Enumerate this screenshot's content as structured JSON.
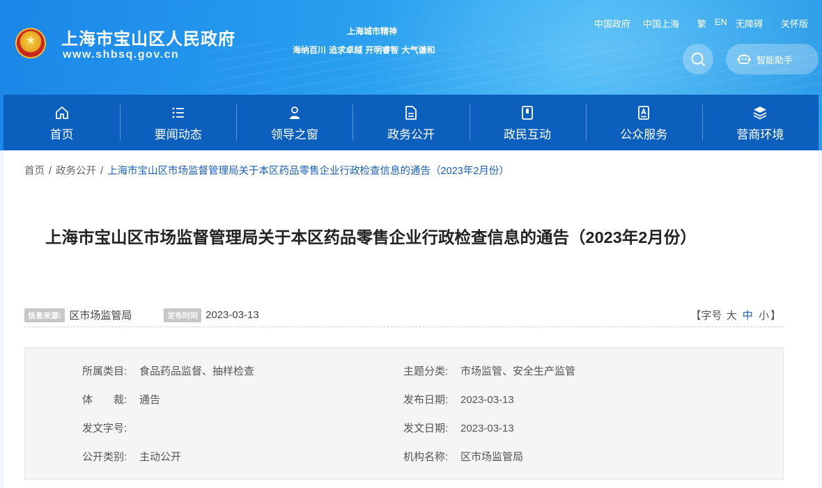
{
  "header": {
    "site_title": "上海市宝山区人民政府",
    "site_url": "www.shbsq.gov.cn",
    "spirit_title": "上海城市精神",
    "spirit_motto": "海纳百川 追求卓越 开明睿智 大气谦和",
    "top_links": {
      "china_gov": "中国政府",
      "shanghai": "中国上海",
      "traditional": "繁",
      "english": "EN",
      "accessibility": "无障碍",
      "care": "关怀版"
    },
    "assistant_label": "智能助手"
  },
  "nav": {
    "items": [
      {
        "label": "首页",
        "icon": "home-icon"
      },
      {
        "label": "要闻动态",
        "icon": "list-icon"
      },
      {
        "label": "领导之窗",
        "icon": "person-icon"
      },
      {
        "label": "政务公开",
        "icon": "document-icon"
      },
      {
        "label": "政民互动",
        "icon": "interaction-icon"
      },
      {
        "label": "公众服务",
        "icon": "service-icon"
      },
      {
        "label": "营商环境",
        "icon": "layers-icon"
      }
    ]
  },
  "breadcrumb": {
    "home": "首页",
    "section": "政务公开",
    "current": "上海市宝山区市场监督管理局关于本区药品零售企业行政检查信息的通告（2023年2月份）",
    "sep": "/"
  },
  "article": {
    "title": "上海市宝山区市场监督管理局关于本区药品零售企业行政检查信息的通告（2023年2月份）",
    "source_tag": "信息来源:",
    "source": "区市场监管局",
    "publish_tag": "发布时间",
    "publish_date": "2023-03-13",
    "font_size": {
      "prefix": "【字号",
      "large": "大",
      "medium": "中",
      "small": "小",
      "suffix": "】"
    }
  },
  "info": {
    "category_label": "所属类目:",
    "category": "食品药品监督、抽样检查",
    "topic_label": "主题分类:",
    "topic": "市场监管、安全生产监管",
    "genre_label": "体　　裁:",
    "genre": "通告",
    "release_date_label": "发布日期:",
    "release_date": "2023-03-13",
    "doc_no_label": "发文字号:",
    "doc_no": "",
    "doc_date_label": "发文日期:",
    "doc_date": "2023-03-13",
    "open_type_label": "公开类别:",
    "open_type": "主动公开",
    "org_label": "机构名称:",
    "org": "区市场监管局"
  },
  "colors": {
    "nav_bg": "#0d5fbe",
    "accent": "#1a5fb8",
    "header_bg": "#2aa0f0"
  }
}
